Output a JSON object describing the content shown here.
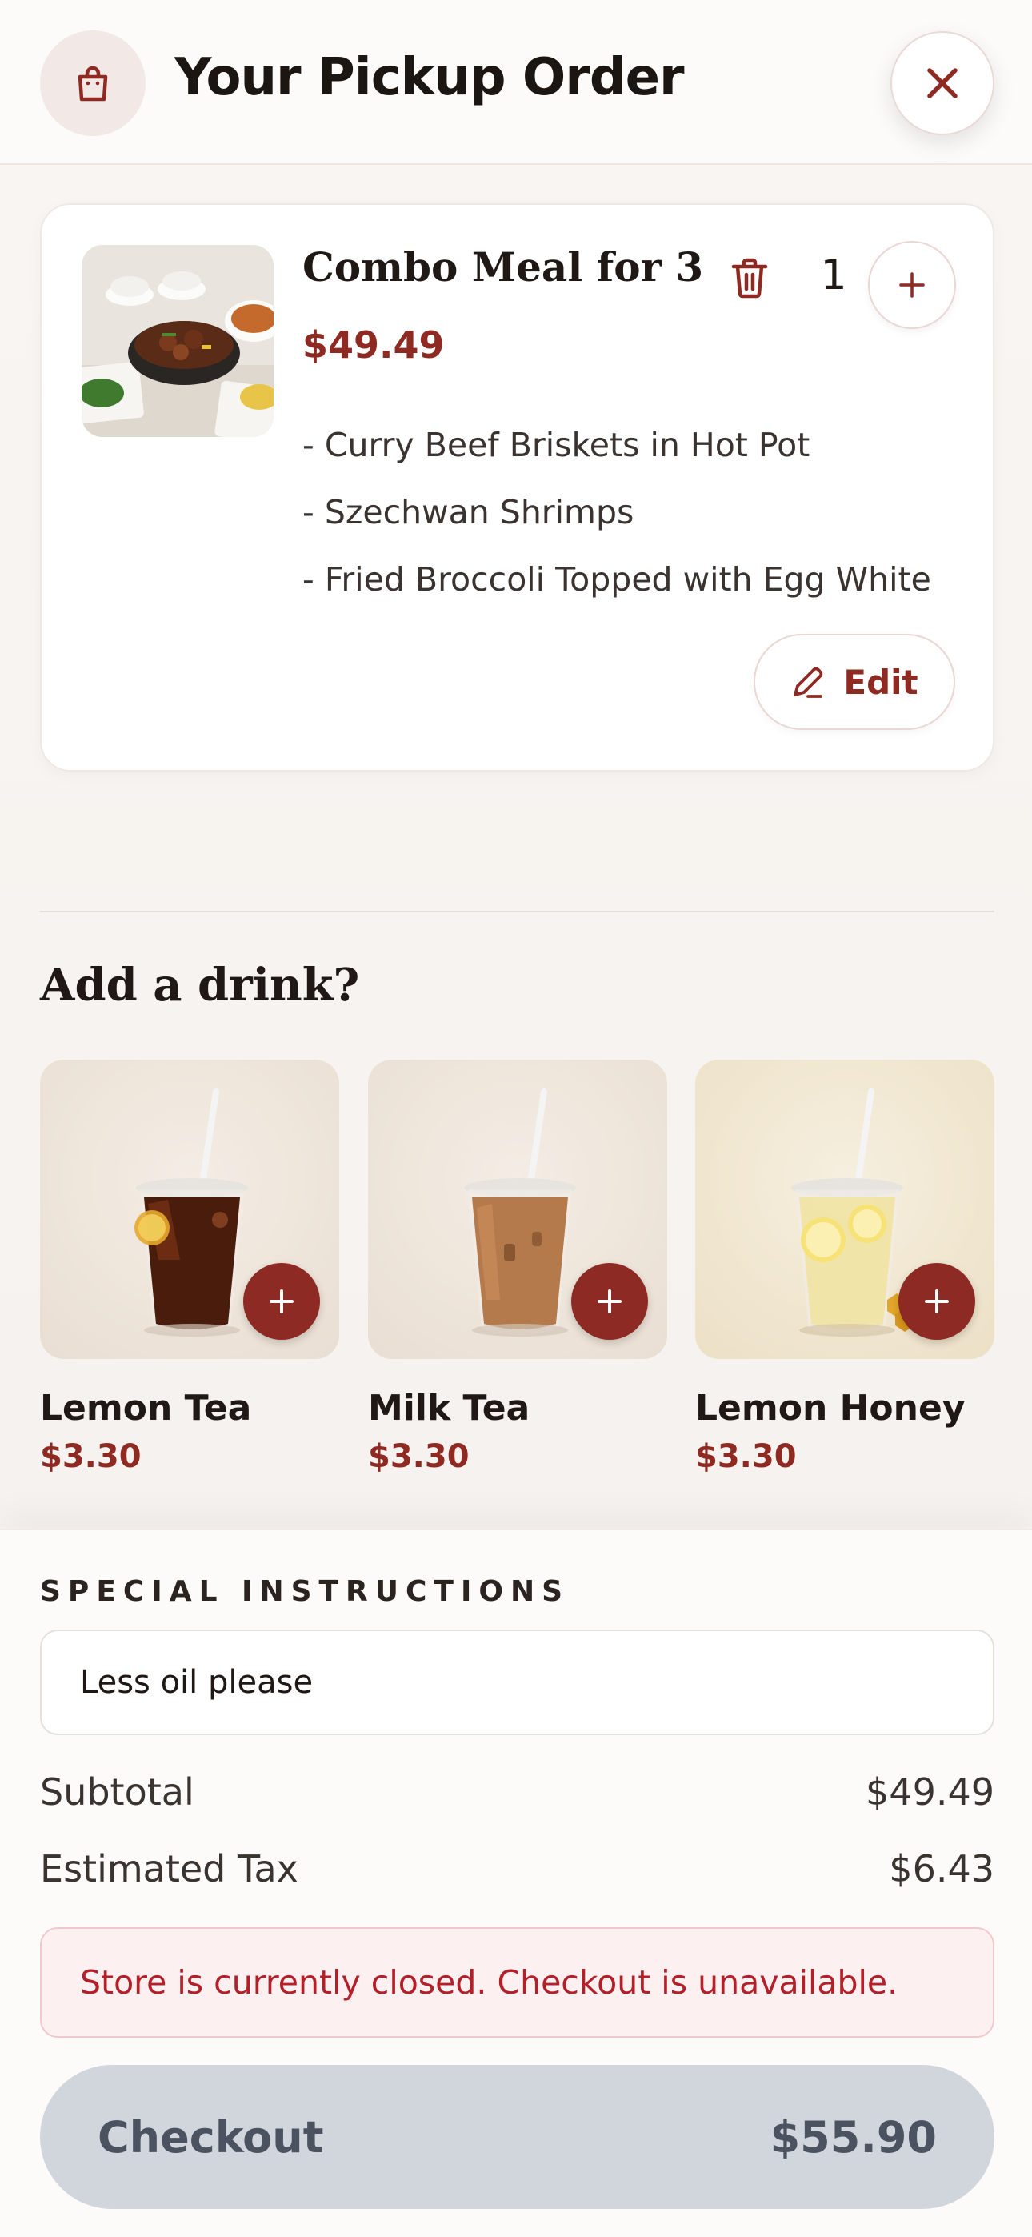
{
  "header": {
    "title": "Your Pickup Order",
    "bag_icon": "shopping-bag-icon",
    "close_icon": "close-icon"
  },
  "cart": {
    "items": [
      {
        "name": "Combo Meal for 3",
        "price": "$49.49",
        "quantity": "1",
        "components": [
          "- Curry Beef Briskets in Hot Pot",
          "- Szechwan Shrimps",
          "- Fried Broccoli Topped with Egg White"
        ],
        "edit_label": "Edit"
      }
    ]
  },
  "drinks": {
    "heading": "Add a drink?",
    "items": [
      {
        "name": "Lemon Tea",
        "price": "$3.30"
      },
      {
        "name": "Milk Tea",
        "price": "$3.30"
      },
      {
        "name": "Lemon Honey",
        "price": "$3.30"
      }
    ]
  },
  "instructions": {
    "label": "SPECIAL INSTRUCTIONS",
    "value": "Less oil please"
  },
  "summary": {
    "subtotal_label": "Subtotal",
    "subtotal_value": "$49.49",
    "tax_label": "Estimated Tax",
    "tax_value": "$6.43"
  },
  "alert": {
    "message": "Store is currently closed. Checkout is unavailable."
  },
  "checkout": {
    "label": "Checkout",
    "total": "$55.90",
    "disabled": true
  },
  "colors": {
    "accent": "#8e2a22",
    "background": "#f7f4f1",
    "alert_text": "#b3202a",
    "alert_bg": "#fdf0f1",
    "checkout_disabled_bg": "#d1d5dc"
  }
}
